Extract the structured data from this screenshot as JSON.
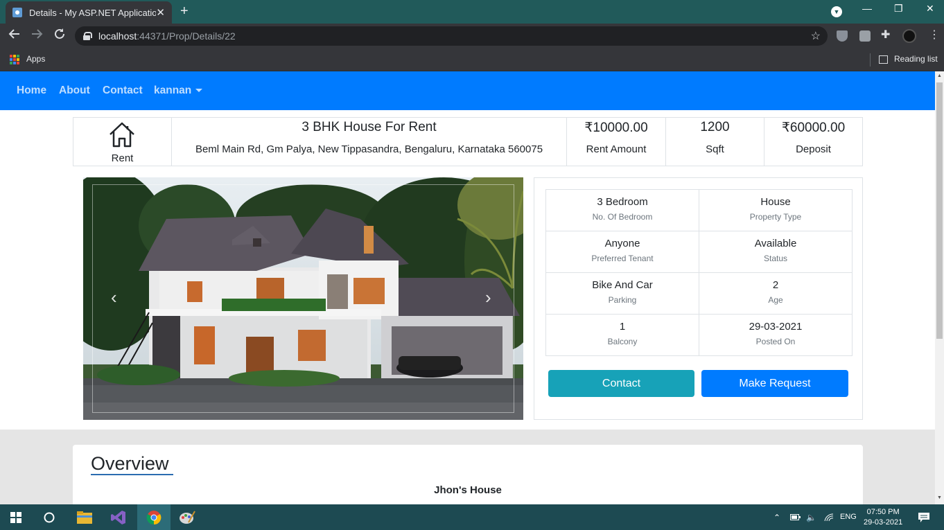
{
  "browser": {
    "tab_title": "Details - My ASP.NET Application",
    "tab_close": "✕",
    "new_tab": "+",
    "url_host": "localhost",
    "url_path": ":44371/Prop/Details/22",
    "bookmarks_apps": "Apps",
    "reading_list": "Reading list",
    "window_minimize": "—",
    "window_restore": "❐",
    "window_close": "✕"
  },
  "navbar": {
    "items": [
      "Home",
      "About",
      "Contact",
      "kannan"
    ]
  },
  "summary": {
    "type_label": "Rent",
    "title": "3 BHK House For Rent",
    "address": "Beml Main Rd, Gm Palya, New Tippasandra, Bengaluru, Karnataka 560075",
    "rent_value": "₹10000.00",
    "rent_label": "Rent Amount",
    "area_value": "1200",
    "area_label": "Sqft",
    "deposit_value": "₹60000.00",
    "deposit_label": "Deposit"
  },
  "carousel": {
    "prev": "‹",
    "next": "›"
  },
  "details": [
    {
      "value": "3 Bedroom",
      "label": "No. Of Bedroom"
    },
    {
      "value": "House",
      "label": "Property Type"
    },
    {
      "value": "Anyone",
      "label": "Preferred Tenant"
    },
    {
      "value": "Available",
      "label": "Status"
    },
    {
      "value": "Bike And Car",
      "label": "Parking"
    },
    {
      "value": "2",
      "label": "Age"
    },
    {
      "value": "1",
      "label": "Balcony"
    },
    {
      "value": "29-03-2021",
      "label": "Posted On"
    }
  ],
  "buttons": {
    "contact": "Contact",
    "request": "Make Request"
  },
  "overview": {
    "title": "Overview",
    "subtitle": "Jhon's House"
  },
  "taskbar": {
    "lang": "ENG",
    "time": "07:50 PM",
    "date": "29-03-2021"
  },
  "colors": {
    "navbar": "#007bff",
    "contact_button": "#17a2b8",
    "request_button": "#007bff",
    "browser_frame": "#35363a",
    "taskbar": "#1d4a52"
  },
  "icons": [
    "home-icon",
    "chevron-left-icon",
    "chevron-right-icon",
    "lock-icon",
    "star-icon",
    "back-arrow-icon",
    "forward-arrow-icon",
    "reload-icon",
    "windows-start-icon",
    "cortana-icon",
    "file-explorer-icon",
    "visual-studio-icon",
    "chrome-icon",
    "paint-icon"
  ]
}
